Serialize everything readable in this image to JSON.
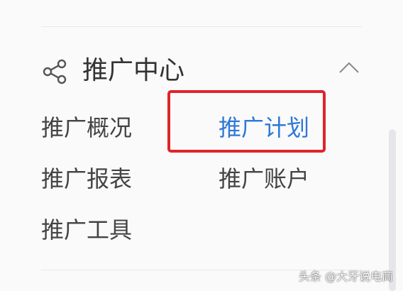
{
  "section": {
    "title": "推广中心",
    "icon": "share-icon",
    "toggle_icon": "chevron-up-icon"
  },
  "menu": {
    "items": [
      {
        "label": "推广概况",
        "active": false
      },
      {
        "label": "推广计划",
        "active": true
      },
      {
        "label": "推广报表",
        "active": false
      },
      {
        "label": "推广账户",
        "active": false
      },
      {
        "label": "推广工具",
        "active": false
      }
    ]
  },
  "colors": {
    "active": "#2e78d6",
    "text": "#444444",
    "highlight_border": "#e0242b",
    "background": "#fafafb"
  },
  "watermark": "头条 @大牙说电商"
}
